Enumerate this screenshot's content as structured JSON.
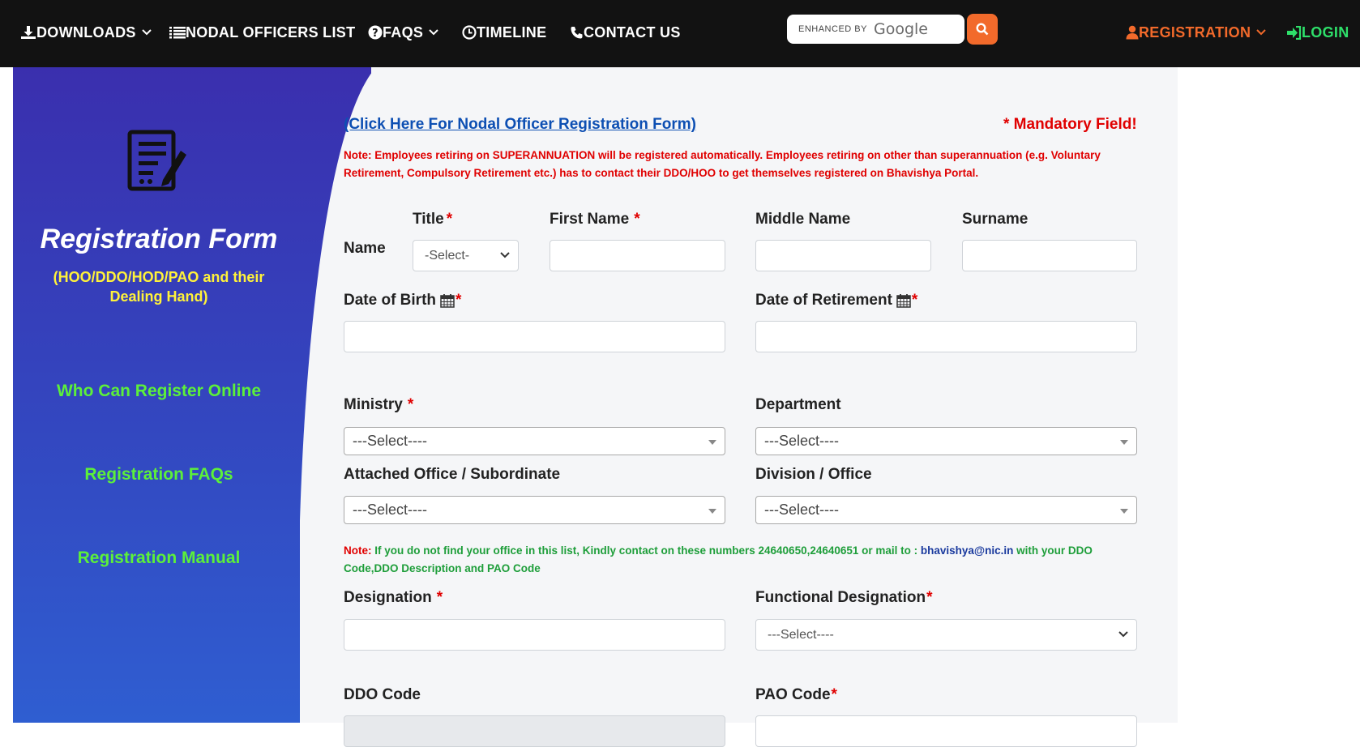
{
  "nav": {
    "downloads": "DOWNLOADS",
    "nodal_officers": "NODAL OFFICERS LIST",
    "faqs": "FAQS",
    "timeline": "TIMELINE",
    "contact": "CONTACT US",
    "registration": "REGISTRATION",
    "login": "LOGIN"
  },
  "search": {
    "enhanced_by": "ENHANCED BY",
    "google": "Google"
  },
  "sidebar": {
    "title": "Registration Form",
    "subtitle": "(HOO/DDO/HOD/PAO and their Dealing Hand)",
    "links": [
      "Who Can Register Online",
      "Registration FAQs",
      "Registration Manual"
    ]
  },
  "form": {
    "nodal_link": "(Click Here For Nodal Officer Registration Form)",
    "mandatory": "* Mandatory Field!",
    "note": "Note: Employees retiring on SUPERANNUATION will be registered automatically. Employees retiring on other than superannuation (e.g. Voluntary Retirement, Compulsory Retirement etc.) has to contact their DDO/HOO to get themselves registered on Bhavishya Portal.",
    "name_label": "Name",
    "title_label": "Title",
    "title_value": "-Select-",
    "first_name_label": "First Name",
    "middle_name_label": "Middle Name",
    "surname_label": "Surname",
    "dob_label": "Date of Birth",
    "dor_label": "Date of Retirement",
    "ministry_label": "Ministry",
    "ministry_value": "---Select----",
    "department_label": "Department",
    "department_value": "---Select----",
    "attached_label": "Attached Office / Subordinate",
    "attached_value": "---Select----",
    "division_label": "Division / Office",
    "division_value": "---Select----",
    "note2_prefix": "Note:",
    "note2_text": " If you do not find your office in this list, Kindly contact on these numbers 24640650,24640651 or mail to : ",
    "note2_mail": "bhavishya@nic.in",
    "note2_suffix": " with your DDO Code,DDO Description and PAO Code",
    "designation_label": "Designation",
    "functional_label": "Functional Designation",
    "functional_value": "---Select----",
    "ddo_label": "DDO Code",
    "pao_label": "PAO Code",
    "required_mark": "*"
  },
  "colors": {
    "nav_bg": "#121212",
    "registration": "#f26a2b",
    "login": "#2ee06a",
    "sidebar_title": "#ffffff",
    "sidebar_sub": "#fff23a",
    "sidebar_links": "#5cf03a",
    "required": "#e00000",
    "link": "#0d4fb3"
  }
}
